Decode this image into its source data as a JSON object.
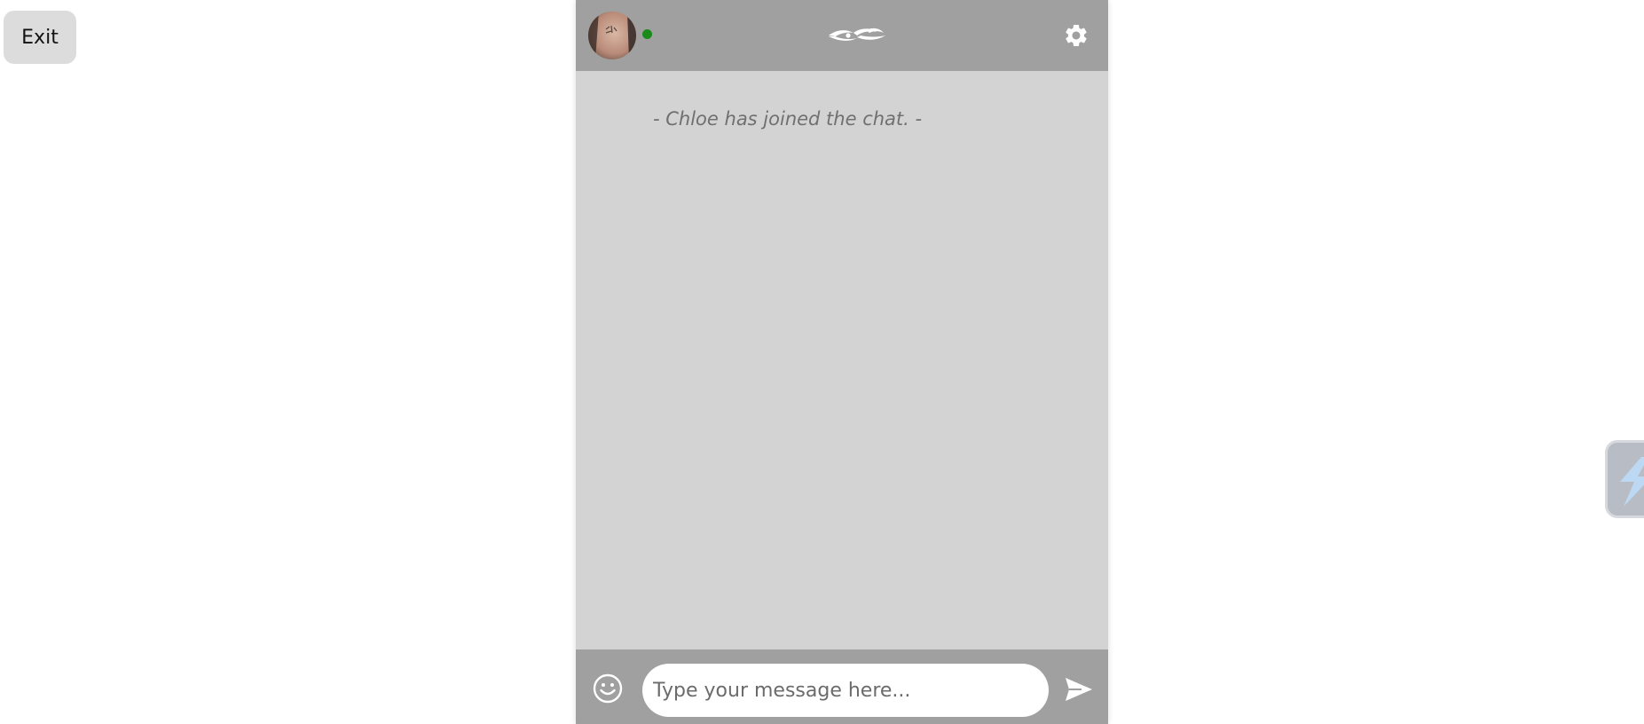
{
  "exit_button": {
    "label": "Exit"
  },
  "header": {
    "avatar_icon": "user-avatar",
    "status": "online",
    "status_color": "#1a8a1a",
    "logo_icon": "brand-logo-icon",
    "settings_icon": "gear-icon"
  },
  "messages": {
    "system_message": "- Chloe has joined the chat. -"
  },
  "composer": {
    "emoji_icon": "smiley-icon",
    "input_placeholder": "Type your message here...",
    "input_value": "",
    "send_icon": "send-icon"
  },
  "side_widget": {
    "icon": "lightning-icon"
  },
  "colors": {
    "header_bg": "#a0a0a0",
    "chat_bg": "#d3d3d3",
    "exit_bg": "#dcdcdc",
    "widget_accent": "#bcd8f2"
  }
}
